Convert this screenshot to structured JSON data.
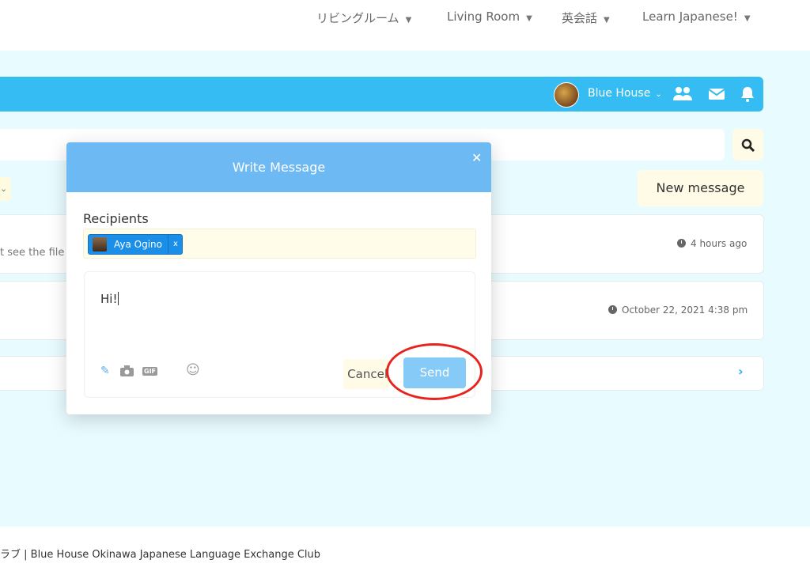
{
  "nav": {
    "items": [
      {
        "label": "リビングルーム"
      },
      {
        "label": "Living Room"
      },
      {
        "label": "英会話"
      },
      {
        "label": "Learn Japanese!"
      }
    ]
  },
  "topbar": {
    "username": "Blue House"
  },
  "actions": {
    "new_message": "New message"
  },
  "messages": [
    {
      "snippet": "t see the file",
      "time": "4 hours ago"
    },
    {
      "snippet": "",
      "time": "October 22, 2021 4:38 pm"
    }
  ],
  "modal": {
    "title": "Write Message",
    "recipients_label": "Recipients",
    "recipient_name": "Aya Ogino",
    "remove_label": "x",
    "body_text": "Hi!",
    "gif_label": "GIF",
    "cancel_label": "Cancel",
    "send_label": "Send"
  },
  "footer": {
    "text": "ラブ | Blue House Okinawa Japanese Language Exchange Club"
  },
  "colors": {
    "accent_bar": "#35bdf3",
    "modal_header": "#6cb9f4",
    "send_button": "#86cbf7",
    "highlight_ring": "#e8231e",
    "page_bg": "#e8fbff"
  }
}
